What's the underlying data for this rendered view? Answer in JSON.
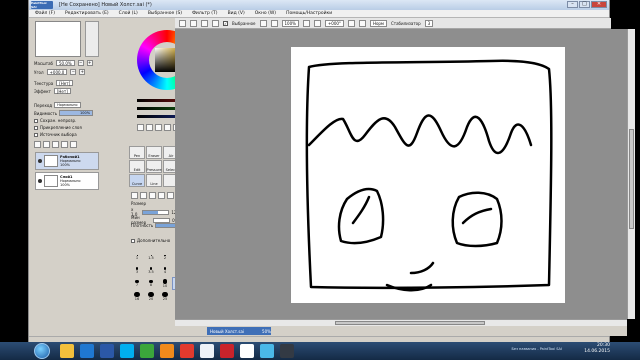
{
  "window": {
    "app_logo": "PaintTool SAI",
    "title": "[Не Сохранено] Новый Холст.sai (*)",
    "min_symbol": "–",
    "max_symbol": "□",
    "close_symbol": "✕"
  },
  "menu": [
    "Файл (F)",
    "Редактировать (E)",
    "Слой (L)",
    "Выбранное (S)",
    "Фильтр (T)",
    "Вид (V)",
    "Окно (W)",
    "Помощь/Настройки"
  ],
  "toolbar": {
    "select_label": "Выбранное",
    "zoom_value": "100%",
    "angle_value": "+000°",
    "normal_label": "Норм",
    "stabilizer_label": "Стабилизатор",
    "stabilizer_value": "3",
    "checked_symbol": "✓"
  },
  "navigator": {
    "scale_label": "Масштаб",
    "scale_value": "50.0%",
    "angle_label": "Угол",
    "angle_value": "+000.0",
    "minus_symbol": "−",
    "plus_symbol": "+"
  },
  "layer_panel": {
    "texture_label": "Текстура",
    "texture_value": "[Нет]",
    "effect_label": "Эффект",
    "effect_value": "[Нет]",
    "new_layer_label": "Новый слой",
    "mode_label": "Переход",
    "mode_value": "Нормально",
    "opacity_label": "Видимость",
    "opacity_value": "100%",
    "preserve_opacity": "Сохран. непрозр.",
    "clipping_group": "Прикрепление слоя",
    "selection_source": "Источник выбора",
    "layers": [
      {
        "name": "Рабочий1",
        "mode": "Нормально",
        "opacity": "100%"
      },
      {
        "name": "Слой1",
        "mode": "Нормально",
        "opacity": "100%"
      }
    ]
  },
  "color_sliders": [
    {
      "color": "#d21e1e",
      "value": "000"
    },
    {
      "color": "#20a020",
      "value": "000"
    },
    {
      "color": "#2040d0",
      "value": "000"
    }
  ],
  "tools": {
    "cells": [
      "Pen",
      "Eraser",
      "Air",
      "Markup",
      "Edit",
      "Pressure",
      "Select",
      "Deselect",
      "Curve",
      "Line",
      "",
      ""
    ],
    "brush_size_label": "Размер",
    "brush_size_mult": "x 1.0",
    "brush_size_value": "12.0",
    "min_size_label": "Мин размер",
    "min_size_value": "0%",
    "density_label": "Плотность",
    "density_value": "100",
    "advanced_label": "Дополнительно",
    "sizes": [
      "1",
      "1.5",
      "2",
      "2.3",
      "2.6",
      "3",
      "3.5",
      "4",
      "5",
      "6",
      "7",
      "8",
      "10",
      "12",
      "14",
      "16",
      "20",
      "25",
      "30",
      "40"
    ],
    "selected_size": "12"
  },
  "document": {
    "tab_name": "Новый Холст.sai",
    "tab_zoom": "50%"
  },
  "taskbar": {
    "time": "20:30",
    "date": "14.06.2015",
    "tray_info": "Без названия - PaintTool SAI"
  }
}
